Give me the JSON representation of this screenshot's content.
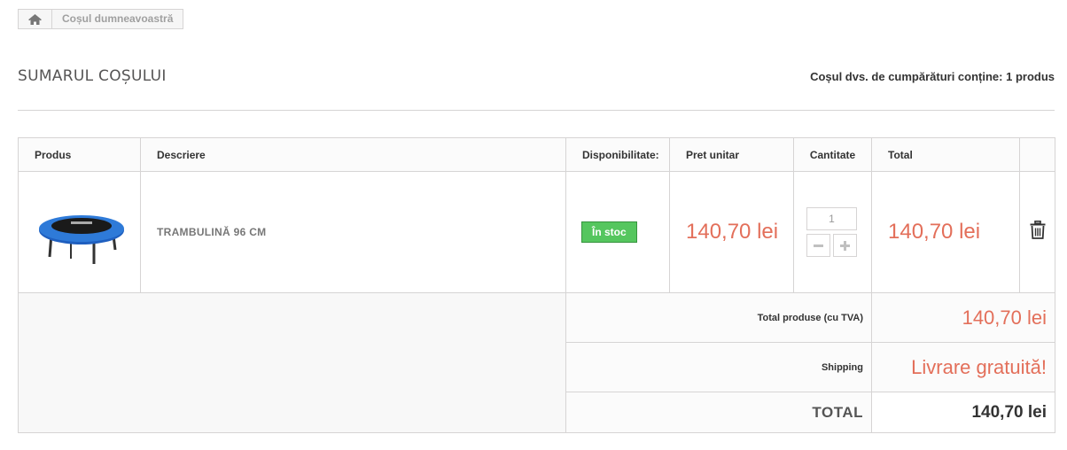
{
  "breadcrumb": {
    "home_icon": "home-icon",
    "current": "Coșul dumneavoastră"
  },
  "heading": {
    "title": "SUMARUL COȘULUI",
    "count_text": "Coșul dvs. de cumpărături conține: 1 produs"
  },
  "table": {
    "columns": [
      "Produs",
      "Descriere",
      "Disponibilitate:",
      "Pret unitar",
      "Cantitate",
      "Total"
    ],
    "rows": [
      {
        "image": "trampoline-image",
        "description": "TRAMBULINĂ 96 CM",
        "availability": "În stoc",
        "unit_price": "140,70 lei",
        "quantity": "1",
        "total": "140,70 lei",
        "delete_icon": "trash-icon"
      }
    ],
    "summary": {
      "products_label": "Total produse (cu TVA)",
      "products_value": "140,70 lei",
      "shipping_label": "Shipping",
      "shipping_value": "Livrare gratuită!",
      "total_label": "TOTAL",
      "total_value": "140,70 lei"
    }
  },
  "colors": {
    "accent_price": "#e36f5a",
    "in_stock": "#55c65e",
    "border": "#d6d4d4"
  }
}
